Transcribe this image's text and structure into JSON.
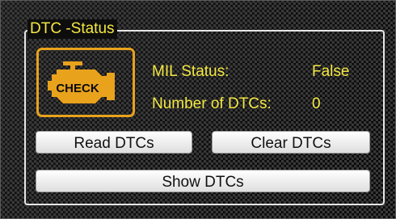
{
  "group": {
    "title": "DTC -Status"
  },
  "check_icon": {
    "label": "CHECK",
    "color": "#e8a21c"
  },
  "status": {
    "mil_label": "MIL Status:",
    "mil_value": "False",
    "dtc_count_label": "Number of DTCs:",
    "dtc_count_value": "0"
  },
  "buttons": {
    "read": "Read DTCs",
    "clear": "Clear DTCs",
    "show": "Show DTCs"
  },
  "colors": {
    "text": "#f4e842",
    "accent": "#e8a21c"
  }
}
